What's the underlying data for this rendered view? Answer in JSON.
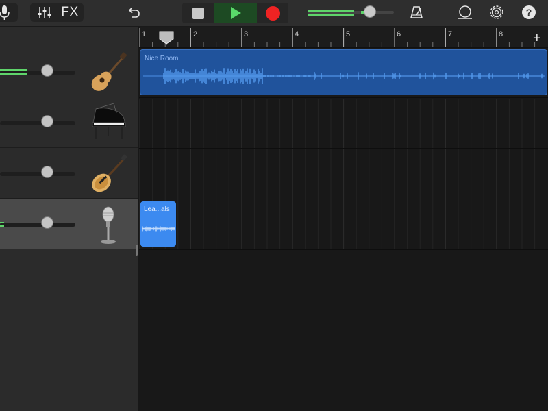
{
  "toolbar": {
    "fx_label": "FX",
    "icons": [
      "microphone-icon",
      "mixer-sliders-icon",
      "undo-icon",
      "stop-icon",
      "play-icon",
      "record-icon",
      "metronome-icon",
      "loop-icon",
      "settings-gear-icon",
      "help-icon"
    ],
    "help_label": "?",
    "master_volume": 0.68
  },
  "ruler": {
    "bars": [
      "1",
      "2",
      "3",
      "4",
      "5",
      "6",
      "7",
      "8"
    ],
    "add_label": "+"
  },
  "tracks": [
    {
      "instrument": "acoustic-guitar",
      "volume": 0.55,
      "meter": 0.36
    },
    {
      "instrument": "grand-piano",
      "volume": 0.55,
      "meter": 0
    },
    {
      "instrument": "electric-guitar",
      "volume": 0.55,
      "meter": 0
    },
    {
      "instrument": "microphone",
      "volume": 0.55,
      "meter": 0.05
    }
  ],
  "regions": {
    "nice_room": "Nice Room",
    "lead_vocals": "Lea...als"
  },
  "colors": {
    "accent_green": "#5fd46b",
    "record_red": "#ef2323",
    "region_blue": "#20539c",
    "region_light_blue": "#3c8af0"
  }
}
